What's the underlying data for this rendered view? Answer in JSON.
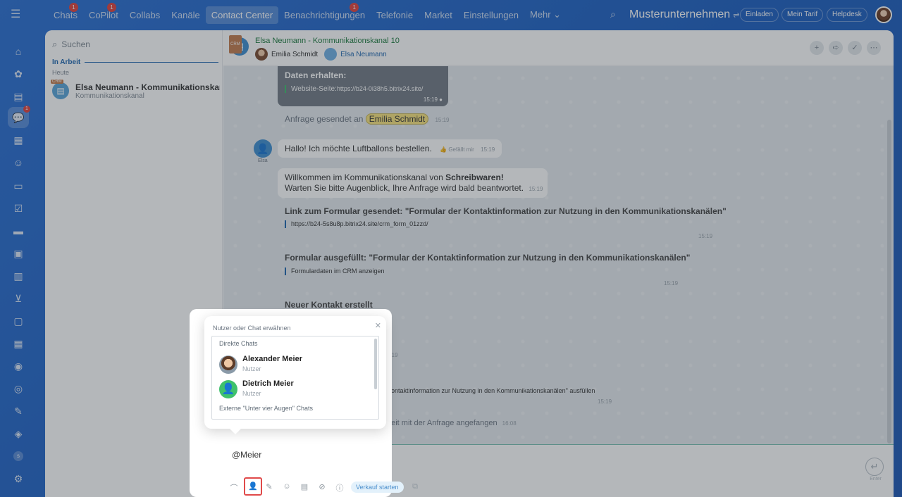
{
  "topbar": {
    "menu": [
      {
        "label": "Chats",
        "count": "1"
      },
      {
        "label": "CoPilot",
        "count": "1"
      },
      {
        "label": "Collabs",
        "count": ""
      },
      {
        "label": "Kanäle",
        "count": ""
      },
      {
        "label": "Contact Center",
        "count": ""
      },
      {
        "label": "Benachrichtigungen",
        "count": "1"
      },
      {
        "label": "Telefonie",
        "count": ""
      },
      {
        "label": "Market",
        "count": ""
      },
      {
        "label": "Einstellungen",
        "count": ""
      },
      {
        "label": "Mehr ⌄",
        "count": ""
      }
    ],
    "company": "Musterunternehmen",
    "invite": "Einladen",
    "plan": "Mein Tarif",
    "help": "Helpdesk"
  },
  "leftnav": {
    "chat_count": "1",
    "avatar_letter": "s"
  },
  "list": {
    "search_placeholder": "Suchen",
    "section": "In Arbeit",
    "today": "Heute",
    "chat_title": "Elsa Neumann - Kommunikationskan...",
    "chat_sub": "Kommunikationskanal",
    "crm_tag": "CRM"
  },
  "header": {
    "title": "Elsa Neumann - Kommunikationskanal 10",
    "member1": "Emilia Schmidt",
    "member2": "Elsa Neumann"
  },
  "messages": {
    "data_received": "Daten erhalten:",
    "website_label": "Website-Seite:",
    "website_url": "https://b24-0i38h5.bitrix24.site/",
    "time1": "15:19",
    "request_sent": "Anfrage gesendet an",
    "request_to": "Emilia Schmidt",
    "hello": "Hallo! Ich möchte Luftballons bestellen.",
    "like": "Gefällt mir",
    "elsa_label": "Elsa",
    "welcome_prefix": "Willkommen im Kommunikationskanal von ",
    "welcome_company": "Schreibwaren!",
    "welcome_line2": "Warten Sie bitte Augenblick, Ihre Anfrage wird bald beantwortet.",
    "link_title": "Link zum Formular gesendet: \"Formular der Kontaktinformation zur Nutzung in den Kommunikationskanälen\"",
    "link_url": "https://b24-5s8u8p.bitrix24.site/crm_form_01zzd/",
    "filled_title": "Formular ausgefüllt: \"Formular der Kontaktinformation zur Nutzung in den Kommunikationskanälen\"",
    "filled_link": "Formulardaten im CRM anzeigen",
    "new_contact": "Neuer Kontakt erstellt",
    "fill_partial": "Kontaktinformation zur Nutzung in den Kommunikationskanälen\" ausfüllen",
    "work_partial": "beit mit der Anfrage angefangen",
    "time_work": "16:08",
    "time_partial": "5:19"
  },
  "popup": {
    "title": "Nutzer oder Chat erwähnen",
    "direct": "Direkte Chats",
    "users": [
      {
        "name": "Alexander Meier",
        "role": "Nutzer"
      },
      {
        "name": "Dietrich Meier",
        "role": "Nutzer"
      }
    ],
    "external": "Externe \"Unter vier Augen\" Chats"
  },
  "input": {
    "text": "@Meier",
    "sales_button": "Verkauf starten",
    "send_label": "Enter"
  }
}
